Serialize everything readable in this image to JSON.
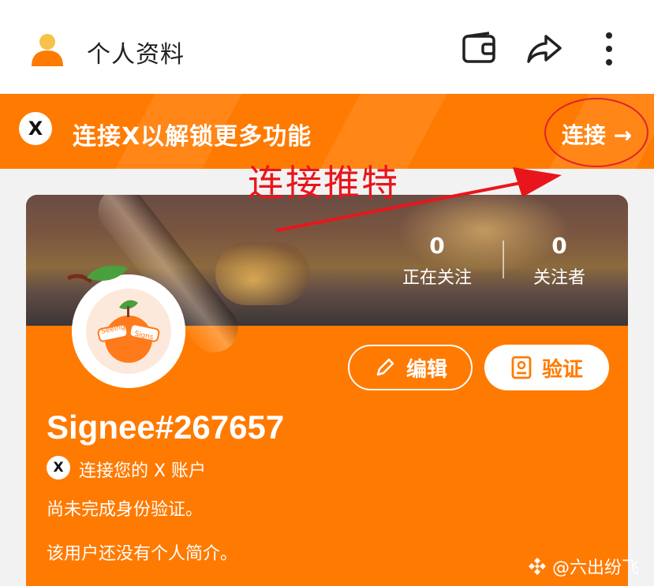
{
  "header": {
    "title": "个人资料",
    "avatar_icon": "user-avatar-icon",
    "icons": [
      "wallet-icon",
      "share-icon",
      "more-icon"
    ]
  },
  "banner": {
    "x_icon_text": "X",
    "text": "连接X以解锁更多功能",
    "connect_label": "连接 →"
  },
  "annotation": {
    "text": "连接推特",
    "color": "#e8161c"
  },
  "profile": {
    "following_count": "0",
    "following_label": "正在关注",
    "followers_count": "0",
    "followers_label": "关注者",
    "edit_label": "编辑",
    "verify_label": "验证",
    "username": "Signee#267657",
    "x_icon_text": "X",
    "connect_x_label": "连接您的 X 账户",
    "verification_status": "尚未完成身份验证。",
    "bio": "该用户还没有个人简介。",
    "avatar_text_left": "Seeing",
    "avatar_text_right": "Signs"
  },
  "watermark": "@六出纷飞",
  "colors": {
    "accent": "#ff7a00",
    "white": "#ffffff"
  }
}
